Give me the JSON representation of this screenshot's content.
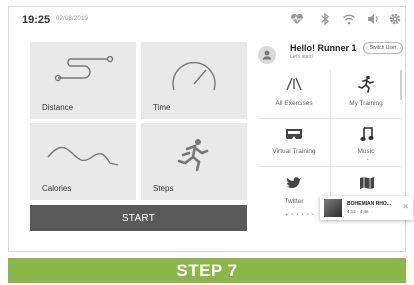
{
  "status": {
    "time": "19:25",
    "date": "02/08/2019"
  },
  "tiles": {
    "distance": "Distance",
    "time": "Time",
    "calories": "Calories",
    "steps": "Steps"
  },
  "start_label": "START",
  "user": {
    "greeting": "Hello! Runner 1",
    "subtext": "Let's start!",
    "switch_label": "Switch User"
  },
  "menu": [
    {
      "label": "All Exercises",
      "icon": "all-exercises-icon"
    },
    {
      "label": "My Training",
      "icon": "runner-icon"
    },
    {
      "label": "Virtual Training",
      "icon": "virtual-training-icon"
    },
    {
      "label": "Music",
      "icon": "music-icon"
    },
    {
      "label": "Twitter",
      "icon": "twitter-icon"
    },
    {
      "label": "",
      "icon": "map-icon"
    }
  ],
  "pager": {
    "twitter_dots": "● • • • • •",
    "music_dot": "•"
  },
  "music_player": {
    "song": "BOHEMIAN RHO...",
    "progress_time": "4:12 - 4:46"
  },
  "banner": "STEP 7",
  "colors": {
    "banner": "#8ab848",
    "start": "#595959",
    "tile": "#e9e9e9"
  }
}
